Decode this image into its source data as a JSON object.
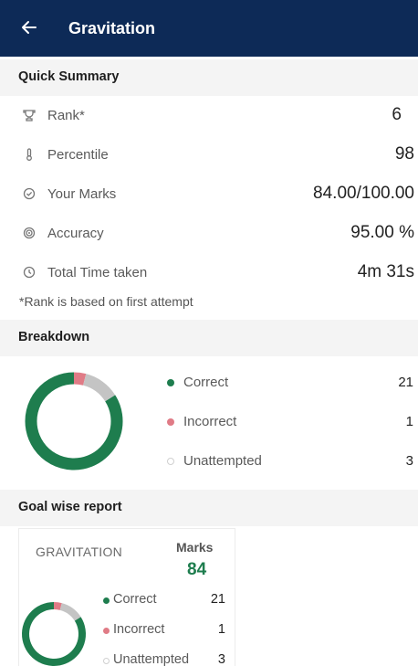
{
  "appbar": {
    "title": "Gravitation",
    "back_icon": "arrow-left-icon"
  },
  "quick_summary": {
    "title": "Quick Summary",
    "rows": [
      {
        "icon": "trophy-icon",
        "label": "Rank*",
        "value": "6"
      },
      {
        "icon": "thermometer-icon",
        "label": "Percentile",
        "value": "98"
      },
      {
        "icon": "check-circle-icon",
        "label": "Your Marks",
        "value": "84.00/100.00"
      },
      {
        "icon": "target-icon",
        "label": "Accuracy",
        "value": "95.00 %"
      },
      {
        "icon": "clock-icon",
        "label": "Total Time taken",
        "value": "4m 31s"
      }
    ],
    "note": "*Rank is based on first attempt"
  },
  "breakdown": {
    "title": "Breakdown",
    "items": [
      {
        "label": "Correct",
        "value": "21",
        "color": "#1e7d4e"
      },
      {
        "label": "Incorrect",
        "value": "1",
        "color": "#e07b86"
      },
      {
        "label": "Unattempted",
        "value": "3",
        "color": "#c4c4c4"
      }
    ]
  },
  "goal_report": {
    "title": "Goal wise report",
    "card": {
      "name": "GRAVITATION",
      "marks_label": "Marks",
      "marks_value": "84",
      "items": [
        {
          "label": "Correct",
          "value": "21"
        },
        {
          "label": "Incorrect",
          "value": "1"
        },
        {
          "label": "Unattempted",
          "value": "3"
        }
      ]
    }
  },
  "colors": {
    "appbar": "#0d2a57",
    "correct": "#1e7d4e",
    "incorrect": "#e07b86",
    "unattempted": "#c4c4c4"
  }
}
